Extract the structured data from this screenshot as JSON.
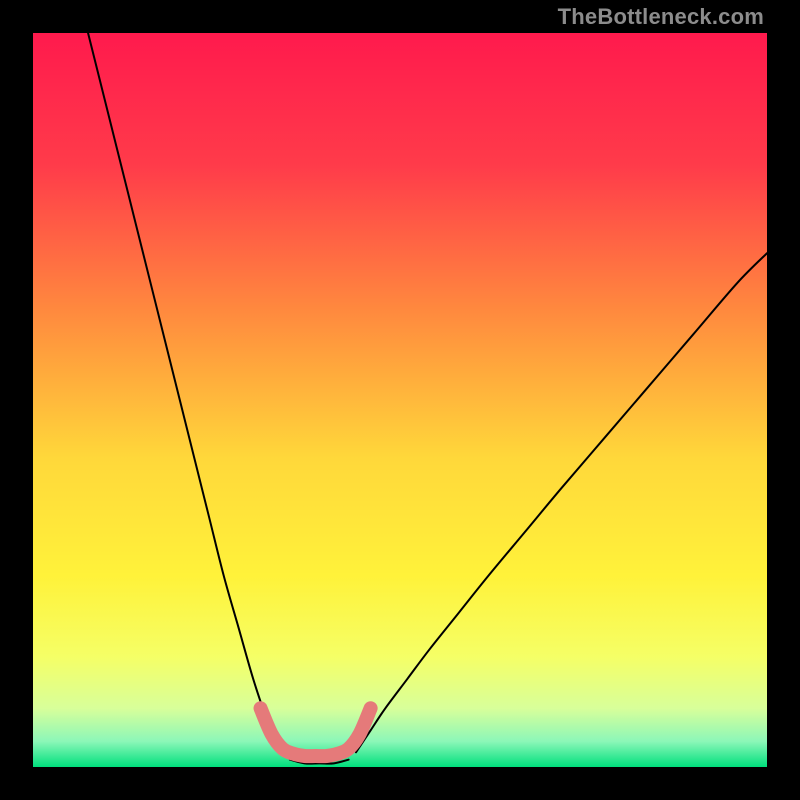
{
  "watermark": "TheBottleneck.com",
  "chart_data": {
    "type": "line",
    "title": "",
    "xlabel": "",
    "ylabel": "",
    "xlim": [
      0,
      100
    ],
    "ylim": [
      0,
      100
    ],
    "gradient_stops": [
      {
        "pos": 0.0,
        "color": "#ff1a4d"
      },
      {
        "pos": 0.18,
        "color": "#ff3b4a"
      },
      {
        "pos": 0.38,
        "color": "#ff8a3e"
      },
      {
        "pos": 0.58,
        "color": "#ffd83a"
      },
      {
        "pos": 0.74,
        "color": "#fff23a"
      },
      {
        "pos": 0.85,
        "color": "#f5ff66"
      },
      {
        "pos": 0.92,
        "color": "#d8ff9a"
      },
      {
        "pos": 0.965,
        "color": "#8cf7b8"
      },
      {
        "pos": 1.0,
        "color": "#00e07d"
      }
    ],
    "series": [
      {
        "name": "left-curve",
        "x": [
          7.5,
          10,
          12,
          14,
          16,
          18,
          20,
          22,
          24,
          26,
          28,
          30,
          32,
          33.5
        ],
        "y": [
          100,
          90,
          82,
          74,
          66,
          58,
          50,
          42,
          34,
          26,
          19,
          12,
          6,
          2
        ]
      },
      {
        "name": "right-curve",
        "x": [
          44,
          46,
          48,
          51,
          54,
          58,
          62,
          67,
          72,
          78,
          84,
          90,
          96,
          100
        ],
        "y": [
          2,
          5,
          8,
          12,
          16,
          21,
          26,
          32,
          38,
          45,
          52,
          59,
          66,
          70
        ]
      },
      {
        "name": "bottom-flat",
        "x": [
          35,
          37,
          39,
          41,
          43
        ],
        "y": [
          1,
          0.5,
          0.5,
          0.5,
          1
        ]
      }
    ],
    "highlight_segment": {
      "name": "pink-marker-band",
      "color": "#e57a7a",
      "stroke_width": 14,
      "points_x": [
        31,
        32.5,
        34,
        35.5,
        37,
        38.5,
        40,
        41.5,
        43,
        44.5,
        46
      ],
      "points_y": [
        8,
        4.5,
        2.5,
        1.8,
        1.5,
        1.5,
        1.5,
        1.8,
        2.5,
        4.5,
        8
      ]
    }
  }
}
